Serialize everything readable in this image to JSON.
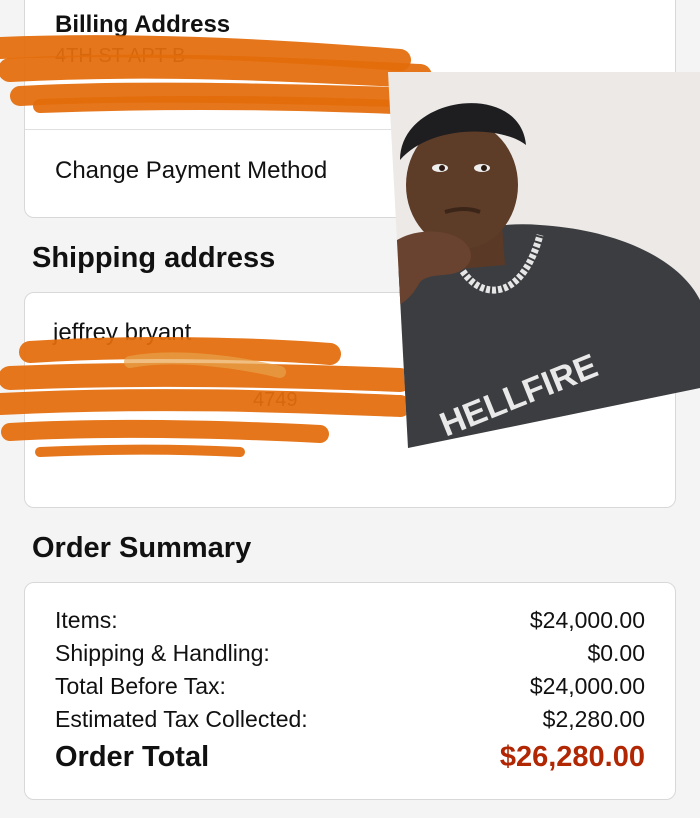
{
  "billing": {
    "title": "Billing Address",
    "address_fragment": "4TH ST APT B",
    "change_label": "Change Payment Method",
    "chevron_icon": "chevron-right-icon"
  },
  "shipping": {
    "title": "Shipping address",
    "name": "jeffrey bryant",
    "phone_fragment": "4749"
  },
  "order_summary": {
    "title": "Order Summary",
    "rows": [
      {
        "label": "Items:",
        "value": "$24,000.00"
      },
      {
        "label": "Shipping & Handling:",
        "value": "$0.00"
      },
      {
        "label": "Total Before Tax:",
        "value": "$24,000.00"
      },
      {
        "label": "Estimated Tax Collected:",
        "value": "$2,280.00"
      }
    ],
    "total": {
      "label": "Order Total",
      "value": "$26,280.00"
    }
  },
  "colors": {
    "total_value": "#b12704",
    "redaction": "#e36c0a",
    "background": "#f4f4f4"
  }
}
